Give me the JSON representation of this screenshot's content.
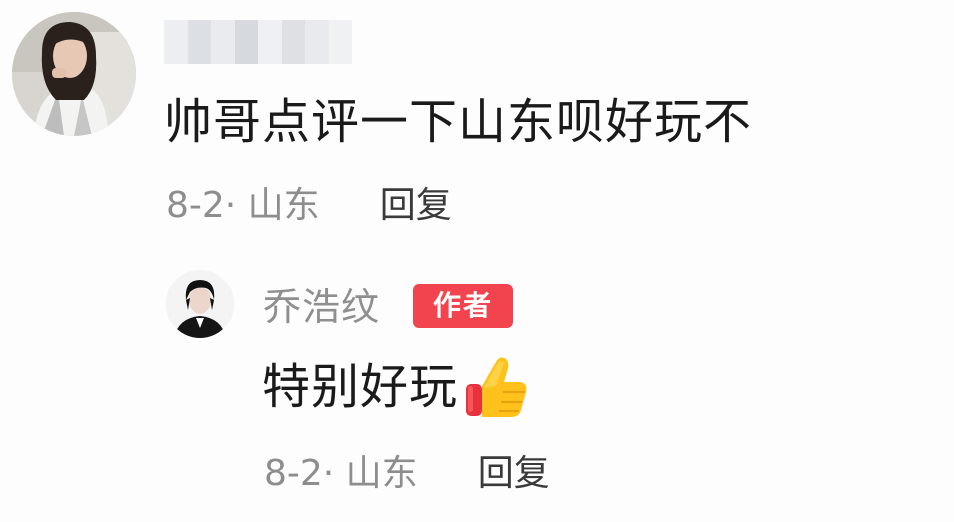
{
  "comment": {
    "text": "帅哥点评一下山东呗好玩不",
    "date_location": "8-2· 山东",
    "reply_label": "回复"
  },
  "reply": {
    "author": "乔浩纹",
    "badge": "作者",
    "text": "特别好玩",
    "emoji": "thumbs-up-icon",
    "date_location": "8-2· 山东",
    "reply_label": "回复"
  },
  "colors": {
    "badge_red": "#f1444f",
    "meta_gray": "#8d8d8d",
    "text_dark": "#1a1a1a"
  }
}
